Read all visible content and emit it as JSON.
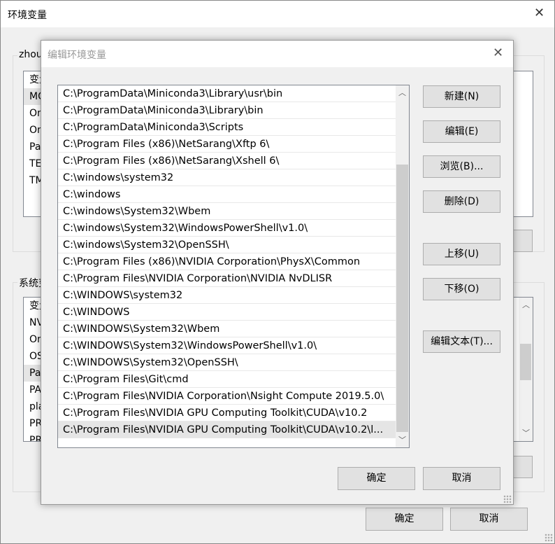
{
  "main_window": {
    "title": "环境变量",
    "user_group_label": "zhou",
    "user_vars": [
      "变量",
      "MO",
      "On",
      "On",
      "Pa",
      "TE",
      "TM"
    ],
    "system_group_label": "系统变",
    "system_vars": [
      "变量",
      "NV",
      "On",
      "OS",
      "Pa",
      "PA",
      "pla",
      "PR",
      "PR"
    ],
    "ok": "确定",
    "cancel": "取消"
  },
  "dialog": {
    "title": "编辑环境变量",
    "paths": [
      "C:\\ProgramData\\Miniconda3\\Library\\usr\\bin",
      "C:\\ProgramData\\Miniconda3\\Library\\bin",
      "C:\\ProgramData\\Miniconda3\\Scripts",
      "C:\\Program Files (x86)\\NetSarang\\Xftp 6\\",
      "C:\\Program Files (x86)\\NetSarang\\Xshell 6\\",
      "C:\\windows\\system32",
      "C:\\windows",
      "C:\\windows\\System32\\Wbem",
      "C:\\windows\\System32\\WindowsPowerShell\\v1.0\\",
      "C:\\windows\\System32\\OpenSSH\\",
      "C:\\Program Files (x86)\\NVIDIA Corporation\\PhysX\\Common",
      "C:\\Program Files\\NVIDIA Corporation\\NVIDIA NvDLISR",
      "C:\\WINDOWS\\system32",
      "C:\\WINDOWS",
      "C:\\WINDOWS\\System32\\Wbem",
      "C:\\WINDOWS\\System32\\WindowsPowerShell\\v1.0\\",
      "C:\\WINDOWS\\System32\\OpenSSH\\",
      "C:\\Program Files\\Git\\cmd",
      "C:\\Program Files\\NVIDIA Corporation\\Nsight Compute 2019.5.0\\",
      "C:\\Program Files\\NVIDIA GPU Computing Toolkit\\CUDA\\v10.2",
      "C:\\Program Files\\NVIDIA GPU Computing Toolkit\\CUDA\\v10.2\\l..."
    ],
    "selected_index": 20,
    "buttons": {
      "new": "新建(N)",
      "edit": "编辑(E)",
      "browse": "浏览(B)...",
      "delete": "删除(D)",
      "move_up": "上移(U)",
      "move_down": "下移(O)",
      "edit_text": "编辑文本(T)..."
    },
    "ok": "确定",
    "cancel": "取消"
  }
}
